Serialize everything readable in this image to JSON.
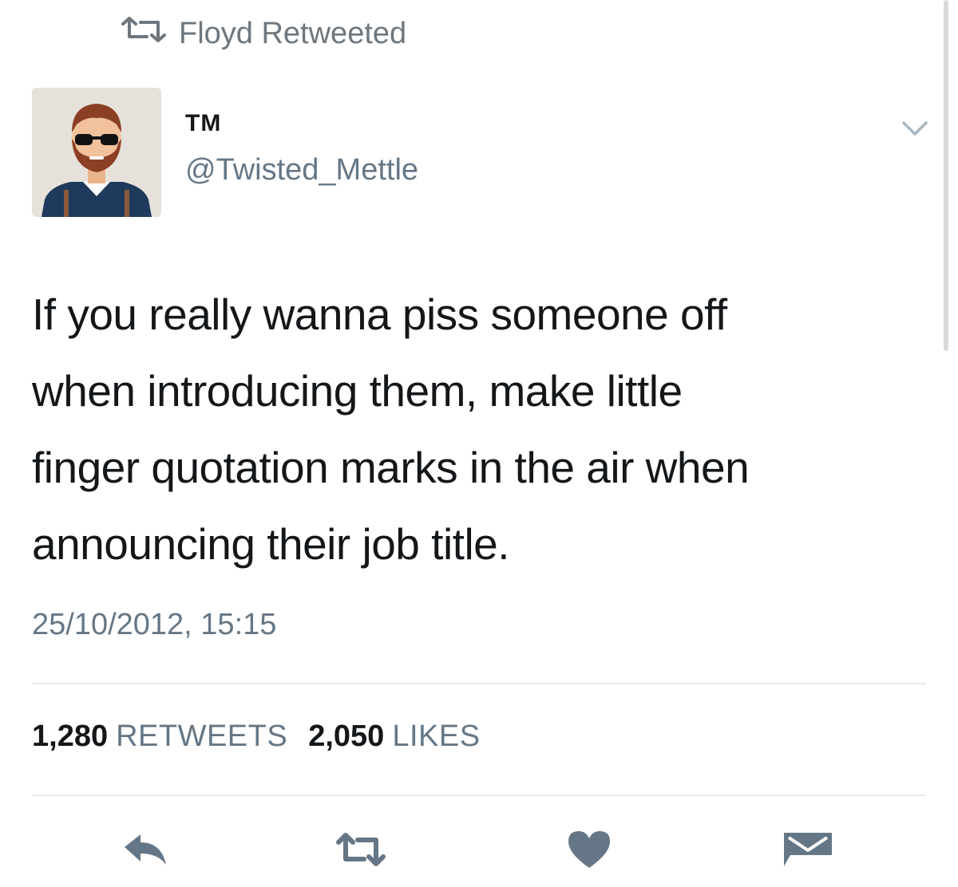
{
  "retweet_context": {
    "icon": "retweet-icon",
    "text": "Floyd Retweeted"
  },
  "author": {
    "display_name": "TM",
    "handle": "@Twisted_Mettle",
    "avatar": "avatar-illustration-bearded-man-sunglasses"
  },
  "tweet": {
    "lines": [
      "If you really wanna piss someone off",
      "when introducing them, make little",
      "finger quotation marks in the air when",
      "announcing their job title."
    ],
    "timestamp": "25/10/2012, 15:15"
  },
  "stats": {
    "retweets_count": "1,280",
    "retweets_label": "RETWEETS",
    "likes_count": "2,050",
    "likes_label": "LIKES"
  },
  "actions": {
    "reply_icon": "reply-icon",
    "retweet_icon": "retweet-icon",
    "like_icon": "heart-icon",
    "dm_icon": "envelope-icon"
  },
  "colors": {
    "text_primary": "#14171a",
    "text_secondary": "#657786",
    "icon_gray": "#657786",
    "divider": "#e6ecf0"
  }
}
